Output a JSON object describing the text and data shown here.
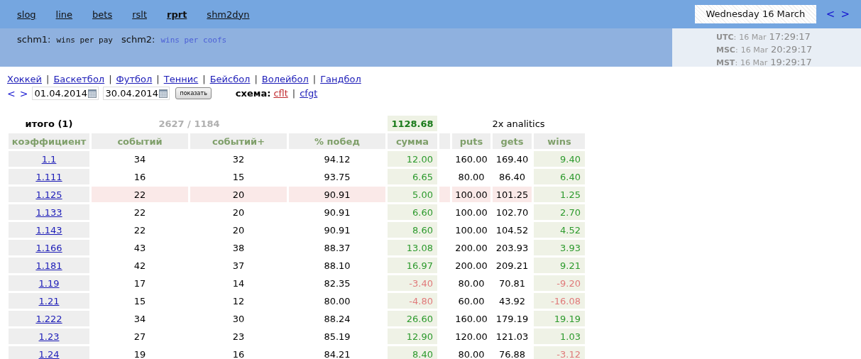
{
  "nav": {
    "items": [
      {
        "label": "slog",
        "selected": false
      },
      {
        "label": "line",
        "selected": false
      },
      {
        "label": "bets",
        "selected": false
      },
      {
        "label": "rslt",
        "selected": false
      },
      {
        "label": "rprt",
        "selected": true
      },
      {
        "label": "shm2dyn",
        "selected": false
      }
    ],
    "date": "Wednesday 16 March",
    "prev": "<",
    "next": ">"
  },
  "schemes": [
    {
      "label": "schm1:",
      "value": "wins per pay",
      "active": false
    },
    {
      "label": "schm2:",
      "value": "wins per coofs",
      "active": true
    }
  ],
  "clocks": [
    {
      "zone": "UTC",
      "separator": ":",
      "date": "16 Mar",
      "time": "17:29:17"
    },
    {
      "zone": "MSC",
      "separator": ":",
      "date": "16 Mar",
      "time": "20:29:17"
    },
    {
      "zone": "MST",
      "separator": ":",
      "date": "16 Mar",
      "time": "19:29:17"
    }
  ],
  "sports": {
    "separator": "|",
    "items": [
      "Хоккей",
      "Баскетбол",
      "Футбол",
      "Теннис",
      "Бейсбол",
      "Волейбол",
      "Гандбол"
    ]
  },
  "filter": {
    "prev": "<",
    "next": ">",
    "date_from": "01.04.2014",
    "date_to": "30.04.2014",
    "button": "показать",
    "schema_label": "схема:",
    "separator": "|",
    "schemas": [
      {
        "label": "cflt",
        "selected": true
      },
      {
        "label": "cfgt",
        "selected": false
      }
    ]
  },
  "table": {
    "total_label": "итого (1)",
    "total_counts": "2627 / 1184",
    "total_sum": "1128.68",
    "analytics_title": "2x analitics",
    "columns": [
      "коэффициент",
      "событий",
      "событий+",
      "% побед",
      "сумма",
      "puts",
      "gets",
      "wins"
    ],
    "rows": [
      {
        "coef": "1.1",
        "events": "34",
        "events_plus": "32",
        "win_pct": "94.12",
        "sum": "12.00",
        "sum_negative": false,
        "puts": "160.00",
        "gets": "169.40",
        "wins": "9.40",
        "wins_negative": false,
        "highlighted": false
      },
      {
        "coef": "1.111",
        "events": "16",
        "events_plus": "15",
        "win_pct": "93.75",
        "sum": "6.65",
        "sum_negative": false,
        "puts": "80.00",
        "gets": "86.40",
        "wins": "6.40",
        "wins_negative": false,
        "highlighted": false
      },
      {
        "coef": "1.125",
        "events": "22",
        "events_plus": "20",
        "win_pct": "90.91",
        "sum": "5.00",
        "sum_negative": false,
        "puts": "100.00",
        "gets": "101.25",
        "wins": "1.25",
        "wins_negative": false,
        "highlighted": true
      },
      {
        "coef": "1.133",
        "events": "22",
        "events_plus": "20",
        "win_pct": "90.91",
        "sum": "6.60",
        "sum_negative": false,
        "puts": "100.00",
        "gets": "102.70",
        "wins": "2.70",
        "wins_negative": false,
        "highlighted": false
      },
      {
        "coef": "1.143",
        "events": "22",
        "events_plus": "20",
        "win_pct": "90.91",
        "sum": "8.60",
        "sum_negative": false,
        "puts": "100.00",
        "gets": "104.52",
        "wins": "4.52",
        "wins_negative": false,
        "highlighted": false
      },
      {
        "coef": "1.166",
        "events": "43",
        "events_plus": "38",
        "win_pct": "88.37",
        "sum": "13.08",
        "sum_negative": false,
        "puts": "200.00",
        "gets": "203.93",
        "wins": "3.93",
        "wins_negative": false,
        "highlighted": false
      },
      {
        "coef": "1.181",
        "events": "42",
        "events_plus": "37",
        "win_pct": "88.10",
        "sum": "16.97",
        "sum_negative": false,
        "puts": "200.00",
        "gets": "209.21",
        "wins": "9.21",
        "wins_negative": false,
        "highlighted": false
      },
      {
        "coef": "1.19",
        "events": "17",
        "events_plus": "14",
        "win_pct": "82.35",
        "sum": "-3.40",
        "sum_negative": true,
        "puts": "80.00",
        "gets": "70.81",
        "wins": "-9.20",
        "wins_negative": true,
        "highlighted": false
      },
      {
        "coef": "1.21",
        "events": "15",
        "events_plus": "12",
        "win_pct": "80.00",
        "sum": "-4.80",
        "sum_negative": true,
        "puts": "60.00",
        "gets": "43.92",
        "wins": "-16.08",
        "wins_negative": true,
        "highlighted": false
      },
      {
        "coef": "1.222",
        "events": "34",
        "events_plus": "30",
        "win_pct": "88.24",
        "sum": "26.60",
        "sum_negative": false,
        "puts": "160.00",
        "gets": "179.19",
        "wins": "19.19",
        "wins_negative": false,
        "highlighted": false
      },
      {
        "coef": "1.23",
        "events": "27",
        "events_plus": "23",
        "win_pct": "85.19",
        "sum": "12.90",
        "sum_negative": false,
        "puts": "120.00",
        "gets": "121.03",
        "wins": "1.03",
        "wins_negative": false,
        "highlighted": false
      },
      {
        "coef": "1.24",
        "events": "19",
        "events_plus": "16",
        "win_pct": "84.21",
        "sum": "8.40",
        "sum_negative": false,
        "puts": "80.00",
        "gets": "76.88",
        "wins": "-3.12",
        "wins_negative": true,
        "highlighted": false
      }
    ]
  }
}
